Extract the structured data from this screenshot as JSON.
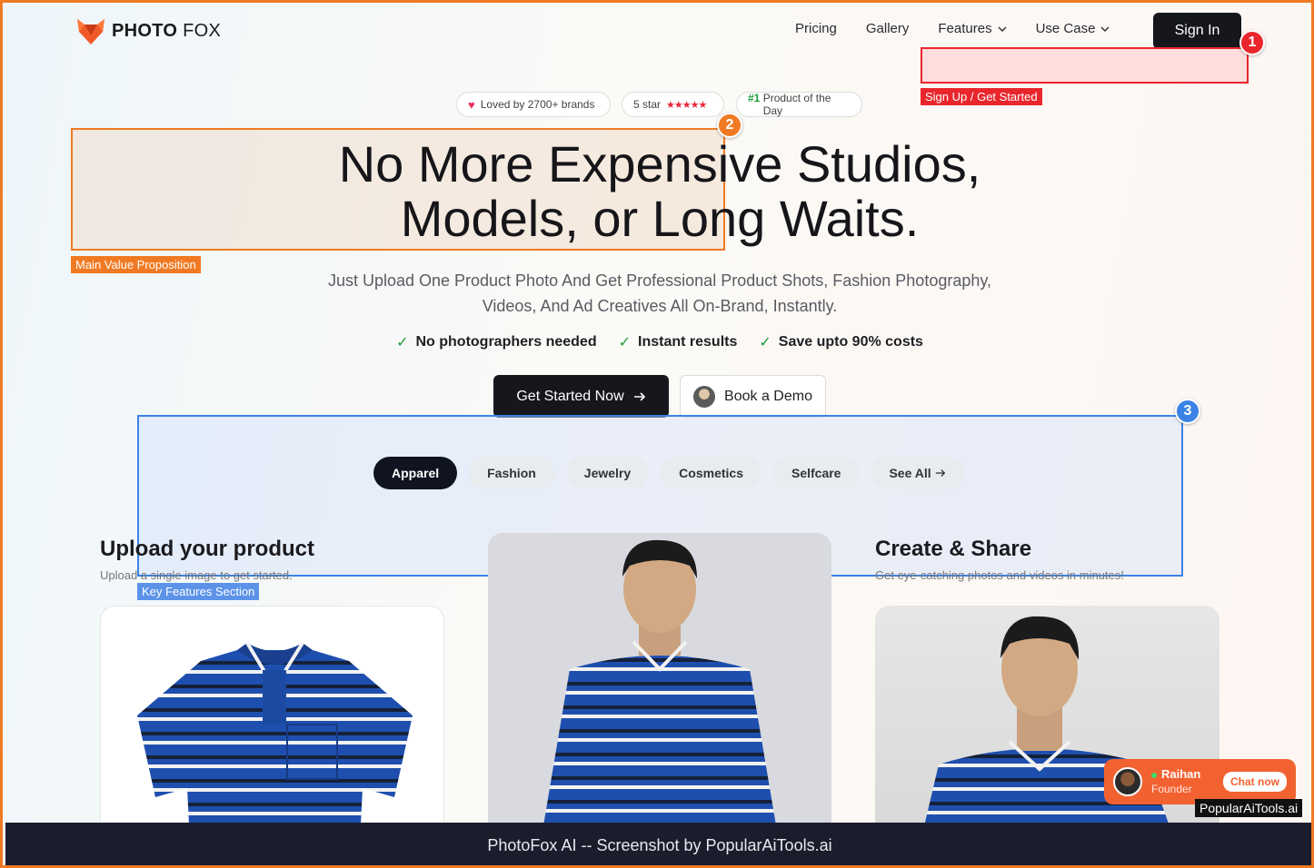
{
  "brand": {
    "name_bold": "PHOTO",
    "name_light": " FOX",
    "color": "#f05a28"
  },
  "nav": {
    "items": [
      {
        "label": "Pricing",
        "dropdown": false
      },
      {
        "label": "Gallery",
        "dropdown": false
      },
      {
        "label": "Features",
        "dropdown": true
      },
      {
        "label": "Use Case",
        "dropdown": true
      }
    ],
    "signin_label": "Sign In"
  },
  "annotations": {
    "a1": {
      "number": "1",
      "label": "Sign Up / Get Started",
      "color": "#e8262c"
    },
    "a2": {
      "number": "2",
      "label": "Main Value Proposition",
      "color": "#f07a23"
    },
    "a3": {
      "number": "3",
      "label": "Key Features Section",
      "color": "#3b82e6"
    }
  },
  "pills": {
    "loved": "Loved by 2700+ brands",
    "star": "5 star",
    "stars": "★★★★★",
    "rank": "#1",
    "product_of_day": "Product of the Day"
  },
  "hero": {
    "headline_1": "No More Expensive Studios,",
    "headline_2": "Models, or Long Waits.",
    "sub_1": "Just Upload One Product Photo And Get Professional Product Shots, Fashion Photography,",
    "sub_2": "Videos, And Ad Creatives All On-Brand, Instantly.",
    "checks": [
      "No photographers needed",
      "Instant results",
      "Save upto 90% costs"
    ],
    "cta_label": "Get Started Now",
    "demo_label": "Book a Demo"
  },
  "categories": {
    "items": [
      "Apparel",
      "Fashion",
      "Jewelry",
      "Cosmetics",
      "Selfcare",
      "See All"
    ],
    "active": "Apparel"
  },
  "steps": {
    "upload": {
      "title": "Upload your product",
      "subtitle": "Upload a single image to get started."
    },
    "share": {
      "title": "Create & Share",
      "subtitle": "Get eye-catching photos and videos in minutes!"
    }
  },
  "chat": {
    "name": "Raihan",
    "role": "Founder",
    "button": "Chat now"
  },
  "watermark": "PopularAiTools.ai",
  "footer": "PhotoFox AI -- Screenshot by PopularAiTools.ai",
  "colors": {
    "accent": "#f07a23",
    "dark": "#15171c",
    "check_green": "#1f9d3a",
    "shirt_blue": "#1f4fae"
  }
}
